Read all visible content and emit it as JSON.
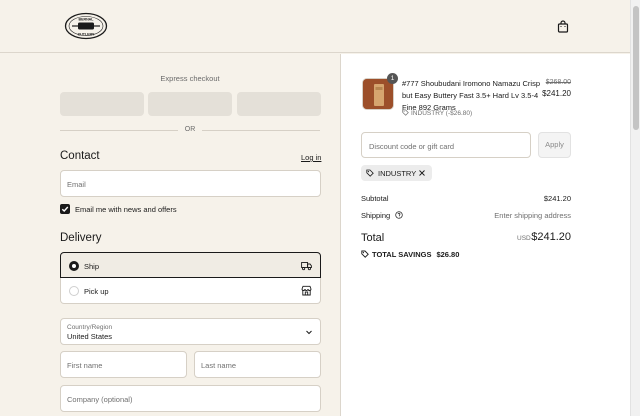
{
  "brand": {
    "logo_line1": "BERNAL",
    "logo_line2": "CUTLERY",
    "logo_icon": "logo-badge"
  },
  "header": {
    "cart_icon": "shopping-bag-icon"
  },
  "express": {
    "title": "Express checkout",
    "or_label": "OR"
  },
  "contact": {
    "title": "Contact",
    "login_label": "Log in",
    "email_placeholder": "Email",
    "newsletter_label": "Email me with news and offers",
    "newsletter_checked": true
  },
  "delivery": {
    "title": "Delivery",
    "options": [
      {
        "label": "Ship",
        "selected": true,
        "icon": "truck-icon"
      },
      {
        "label": "Pick up",
        "selected": false,
        "icon": "store-icon"
      }
    ],
    "country_label": "Country/Region",
    "country_value": "United States",
    "first_name_placeholder": "First name",
    "last_name_placeholder": "Last name",
    "company_placeholder": "Company (optional)"
  },
  "summary": {
    "product": {
      "quantity": "1",
      "name": "#777 Shoubudani Iromono Namazu Crisp but Easy Buttery Fast 3.5+ Hard Lv 3.5-4 Fine 892 Grams",
      "discount_line": "INDUSTRY (-$26.80)",
      "original_price": "$268.00",
      "price": "$241.20"
    },
    "discount_placeholder": "Discount code or gift card",
    "apply_label": "Apply",
    "applied_code": "INDUSTRY",
    "subtotal_label": "Subtotal",
    "subtotal_value": "$241.20",
    "shipping_label": "Shipping",
    "shipping_value": "Enter shipping address",
    "total_label": "Total",
    "currency": "USD",
    "total_value": "$241.20",
    "savings_label": "TOTAL SAVINGS",
    "savings_value": "$26.80"
  },
  "colors": {
    "page_bg": "#f6f2ea",
    "summary_bg": "#ffffff",
    "text": "#1a1a1a",
    "muted": "#707070",
    "express_button": "#e4e0d8"
  }
}
